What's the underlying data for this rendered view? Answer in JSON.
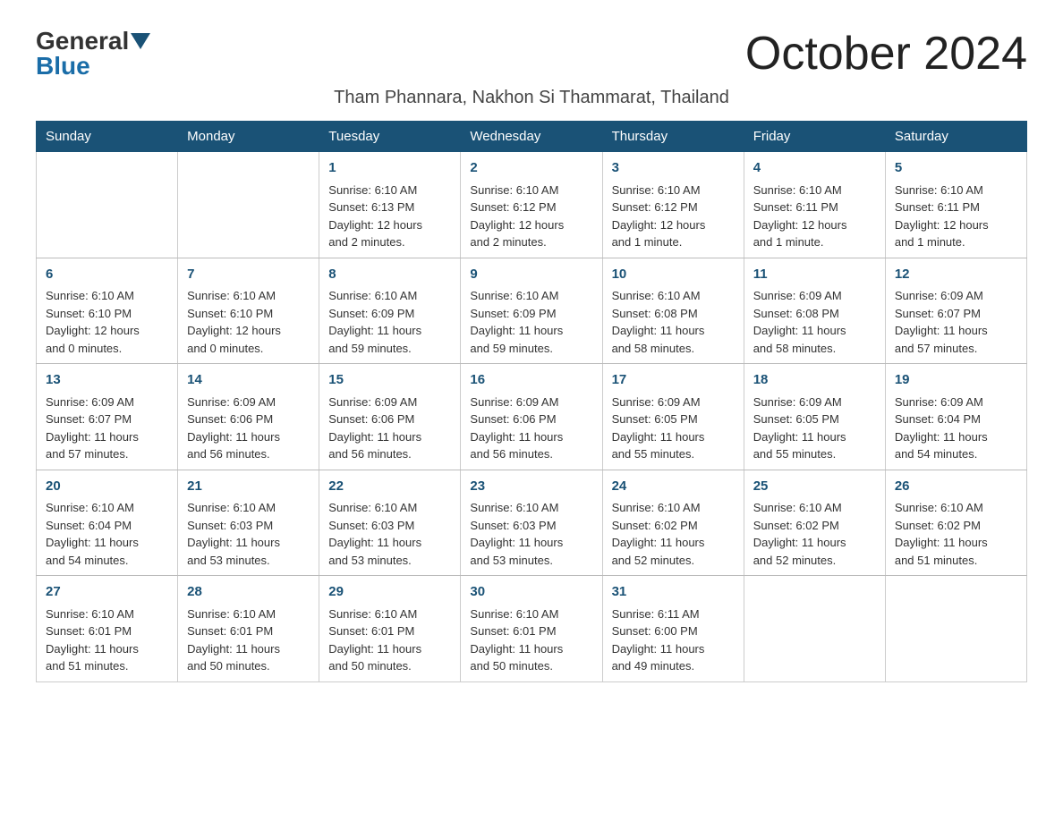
{
  "header": {
    "logo": {
      "general": "General",
      "blue": "Blue"
    },
    "title": "October 2024",
    "subtitle": "Tham Phannara, Nakhon Si Thammarat, Thailand"
  },
  "calendar": {
    "days": [
      "Sunday",
      "Monday",
      "Tuesday",
      "Wednesday",
      "Thursday",
      "Friday",
      "Saturday"
    ],
    "weeks": [
      [
        {
          "num": "",
          "info": ""
        },
        {
          "num": "",
          "info": ""
        },
        {
          "num": "1",
          "info": "Sunrise: 6:10 AM\nSunset: 6:13 PM\nDaylight: 12 hours\nand 2 minutes."
        },
        {
          "num": "2",
          "info": "Sunrise: 6:10 AM\nSunset: 6:12 PM\nDaylight: 12 hours\nand 2 minutes."
        },
        {
          "num": "3",
          "info": "Sunrise: 6:10 AM\nSunset: 6:12 PM\nDaylight: 12 hours\nand 1 minute."
        },
        {
          "num": "4",
          "info": "Sunrise: 6:10 AM\nSunset: 6:11 PM\nDaylight: 12 hours\nand 1 minute."
        },
        {
          "num": "5",
          "info": "Sunrise: 6:10 AM\nSunset: 6:11 PM\nDaylight: 12 hours\nand 1 minute."
        }
      ],
      [
        {
          "num": "6",
          "info": "Sunrise: 6:10 AM\nSunset: 6:10 PM\nDaylight: 12 hours\nand 0 minutes."
        },
        {
          "num": "7",
          "info": "Sunrise: 6:10 AM\nSunset: 6:10 PM\nDaylight: 12 hours\nand 0 minutes."
        },
        {
          "num": "8",
          "info": "Sunrise: 6:10 AM\nSunset: 6:09 PM\nDaylight: 11 hours\nand 59 minutes."
        },
        {
          "num": "9",
          "info": "Sunrise: 6:10 AM\nSunset: 6:09 PM\nDaylight: 11 hours\nand 59 minutes."
        },
        {
          "num": "10",
          "info": "Sunrise: 6:10 AM\nSunset: 6:08 PM\nDaylight: 11 hours\nand 58 minutes."
        },
        {
          "num": "11",
          "info": "Sunrise: 6:09 AM\nSunset: 6:08 PM\nDaylight: 11 hours\nand 58 minutes."
        },
        {
          "num": "12",
          "info": "Sunrise: 6:09 AM\nSunset: 6:07 PM\nDaylight: 11 hours\nand 57 minutes."
        }
      ],
      [
        {
          "num": "13",
          "info": "Sunrise: 6:09 AM\nSunset: 6:07 PM\nDaylight: 11 hours\nand 57 minutes."
        },
        {
          "num": "14",
          "info": "Sunrise: 6:09 AM\nSunset: 6:06 PM\nDaylight: 11 hours\nand 56 minutes."
        },
        {
          "num": "15",
          "info": "Sunrise: 6:09 AM\nSunset: 6:06 PM\nDaylight: 11 hours\nand 56 minutes."
        },
        {
          "num": "16",
          "info": "Sunrise: 6:09 AM\nSunset: 6:06 PM\nDaylight: 11 hours\nand 56 minutes."
        },
        {
          "num": "17",
          "info": "Sunrise: 6:09 AM\nSunset: 6:05 PM\nDaylight: 11 hours\nand 55 minutes."
        },
        {
          "num": "18",
          "info": "Sunrise: 6:09 AM\nSunset: 6:05 PM\nDaylight: 11 hours\nand 55 minutes."
        },
        {
          "num": "19",
          "info": "Sunrise: 6:09 AM\nSunset: 6:04 PM\nDaylight: 11 hours\nand 54 minutes."
        }
      ],
      [
        {
          "num": "20",
          "info": "Sunrise: 6:10 AM\nSunset: 6:04 PM\nDaylight: 11 hours\nand 54 minutes."
        },
        {
          "num": "21",
          "info": "Sunrise: 6:10 AM\nSunset: 6:03 PM\nDaylight: 11 hours\nand 53 minutes."
        },
        {
          "num": "22",
          "info": "Sunrise: 6:10 AM\nSunset: 6:03 PM\nDaylight: 11 hours\nand 53 minutes."
        },
        {
          "num": "23",
          "info": "Sunrise: 6:10 AM\nSunset: 6:03 PM\nDaylight: 11 hours\nand 53 minutes."
        },
        {
          "num": "24",
          "info": "Sunrise: 6:10 AM\nSunset: 6:02 PM\nDaylight: 11 hours\nand 52 minutes."
        },
        {
          "num": "25",
          "info": "Sunrise: 6:10 AM\nSunset: 6:02 PM\nDaylight: 11 hours\nand 52 minutes."
        },
        {
          "num": "26",
          "info": "Sunrise: 6:10 AM\nSunset: 6:02 PM\nDaylight: 11 hours\nand 51 minutes."
        }
      ],
      [
        {
          "num": "27",
          "info": "Sunrise: 6:10 AM\nSunset: 6:01 PM\nDaylight: 11 hours\nand 51 minutes."
        },
        {
          "num": "28",
          "info": "Sunrise: 6:10 AM\nSunset: 6:01 PM\nDaylight: 11 hours\nand 50 minutes."
        },
        {
          "num": "29",
          "info": "Sunrise: 6:10 AM\nSunset: 6:01 PM\nDaylight: 11 hours\nand 50 minutes."
        },
        {
          "num": "30",
          "info": "Sunrise: 6:10 AM\nSunset: 6:01 PM\nDaylight: 11 hours\nand 50 minutes."
        },
        {
          "num": "31",
          "info": "Sunrise: 6:11 AM\nSunset: 6:00 PM\nDaylight: 11 hours\nand 49 minutes."
        },
        {
          "num": "",
          "info": ""
        },
        {
          "num": "",
          "info": ""
        }
      ]
    ]
  }
}
